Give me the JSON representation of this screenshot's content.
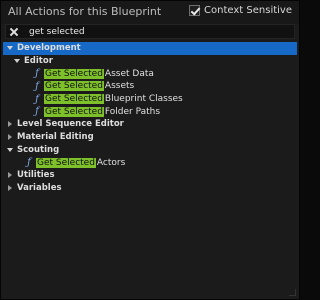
{
  "header": {
    "title": "All Actions for this Blueprint",
    "context_sensitive_label": "Context Sensitive",
    "context_sensitive_checked": true
  },
  "search": {
    "value": "get selected"
  },
  "tree": {
    "development": "Development",
    "editor": "Editor",
    "items_editor": [
      {
        "match": "Get Selected",
        "rest": "Asset Data"
      },
      {
        "match": "Get Selected",
        "rest": "Assets"
      },
      {
        "match": "Get Selected",
        "rest": "Blueprint Classes"
      },
      {
        "match": "Get Selected",
        "rest": "Folder Paths"
      }
    ],
    "level_sequence_editor": "Level Sequence Editor",
    "material_editing": "Material Editing",
    "scouting": "Scouting",
    "items_scouting": [
      {
        "match": "Get Selected",
        "rest": "Actors"
      }
    ],
    "utilities": "Utilities",
    "variables": "Variables"
  },
  "icons": {
    "function": "function-icon",
    "expand": "chevron-down-icon",
    "collapse": "chevron-right-icon"
  },
  "colors": {
    "selection": "#1769c7",
    "highlight": "#7ec02a",
    "function_icon": "#7fa8e8"
  }
}
